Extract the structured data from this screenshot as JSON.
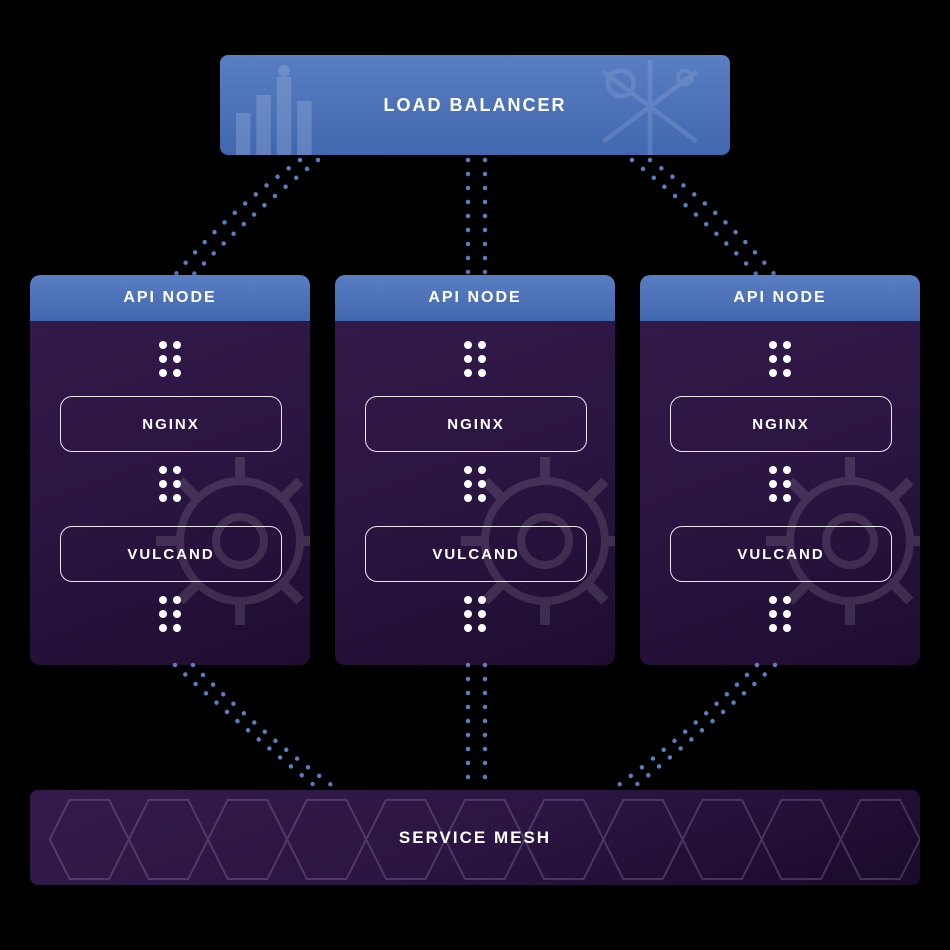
{
  "load_balancer": {
    "label": "LOAD BALANCER"
  },
  "api_nodes": [
    {
      "header": "API NODE",
      "nginx": "NGINX",
      "vulcand": "VULCAND"
    },
    {
      "header": "API NODE",
      "nginx": "NGINX",
      "vulcand": "VULCAND"
    },
    {
      "header": "API NODE",
      "nginx": "NGINX",
      "vulcand": "VULCAND"
    }
  ],
  "service_mesh": {
    "label": "SERVICE MESH"
  },
  "colors": {
    "blue_gradient_top": "#5a7ec2",
    "blue_gradient_bottom": "#4167ae",
    "purple_dark": "#1e0d30",
    "purple_light": "#341a4c",
    "connector_blue": "#5a7ec2"
  }
}
